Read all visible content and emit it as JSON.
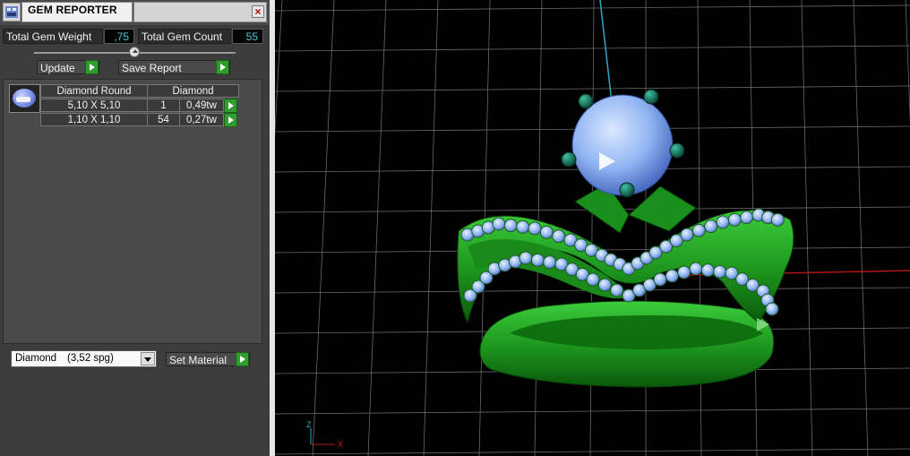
{
  "window": {
    "title": "GEM REPORTER",
    "close_icon": "close-icon"
  },
  "stats": {
    "total_gem_weight_label": "Total Gem Weight",
    "total_gem_weight_value": ",75",
    "total_gem_count_label": "Total Gem Count",
    "total_gem_count_value": "55"
  },
  "actions": {
    "update_label": "Update",
    "save_report_label": "Save Report"
  },
  "report": {
    "shape_header": "Diamond Round",
    "material_header": "Diamond",
    "rows": [
      {
        "size": "5,10 X 5,10",
        "count": "1",
        "weight": "0,49tw"
      },
      {
        "size": "1,10 X 1,10",
        "count": "54",
        "weight": "0,27tw"
      }
    ]
  },
  "material": {
    "selected_name": "Diamond",
    "selected_spg": "(3,52 spg)",
    "set_label": "Set Material"
  },
  "viewport": {
    "axis_z_label": "Z",
    "axis_x_label": "X",
    "ring_color": "#1f8c1f",
    "gem_color": "#8fb4f2"
  },
  "colors": {
    "accent_green": "#2f9e2f",
    "value_cyan": "#40c8d8"
  }
}
